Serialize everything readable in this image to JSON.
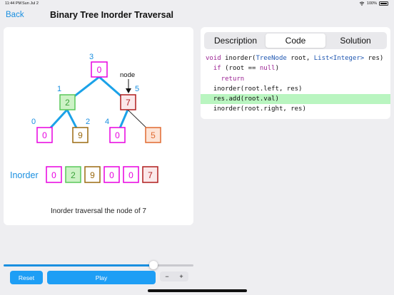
{
  "status": {
    "time": "11:44 PM",
    "date": "Sun Jul 2",
    "battery": "100%"
  },
  "nav": {
    "back": "Back",
    "title": "Binary Tree Inorder Traversal"
  },
  "tabs": [
    {
      "label": "Description",
      "active": false
    },
    {
      "label": "Code",
      "active": true
    },
    {
      "label": "Solution",
      "active": false
    }
  ],
  "code": {
    "lines": [
      "void inorder(TreeNode root, List<Integer> res)",
      "  if (root == null)",
      "    return",
      "  inorder(root.left, res)",
      "  res.add(root.val)",
      "  inorder(root.right, res)"
    ],
    "highlight_index": 4
  },
  "tree": {
    "nodes": [
      {
        "id": "root",
        "value": "0",
        "index": "3"
      },
      {
        "id": "left",
        "value": "2",
        "index": "1"
      },
      {
        "id": "right",
        "value": "7",
        "index": "5"
      },
      {
        "id": "left-left",
        "value": "0",
        "index": "0"
      },
      {
        "id": "left-right",
        "value": "9",
        "index": "2"
      },
      {
        "id": "right-left",
        "value": "0",
        "index": "4"
      },
      {
        "id": "right-right",
        "value": "5",
        "index": ""
      }
    ],
    "pointer_label": "node"
  },
  "inorder": {
    "label": "Inorder",
    "values": [
      "0",
      "2",
      "9",
      "0",
      "0",
      "7"
    ]
  },
  "caption": "Inorder traversal the node of 7",
  "controls": {
    "reset": "Reset",
    "play": "Play",
    "minus": "−",
    "plus": "+",
    "progress": 0.79
  },
  "colors": {
    "accent": "#1a8fe0",
    "button": "#1e9ef5",
    "highlight": "#b9f5c0",
    "pink": "#e800e0",
    "green": "#5ac85a",
    "brown": "#9b6a10",
    "red": "#b01e1e",
    "orange": "#e06a30"
  }
}
